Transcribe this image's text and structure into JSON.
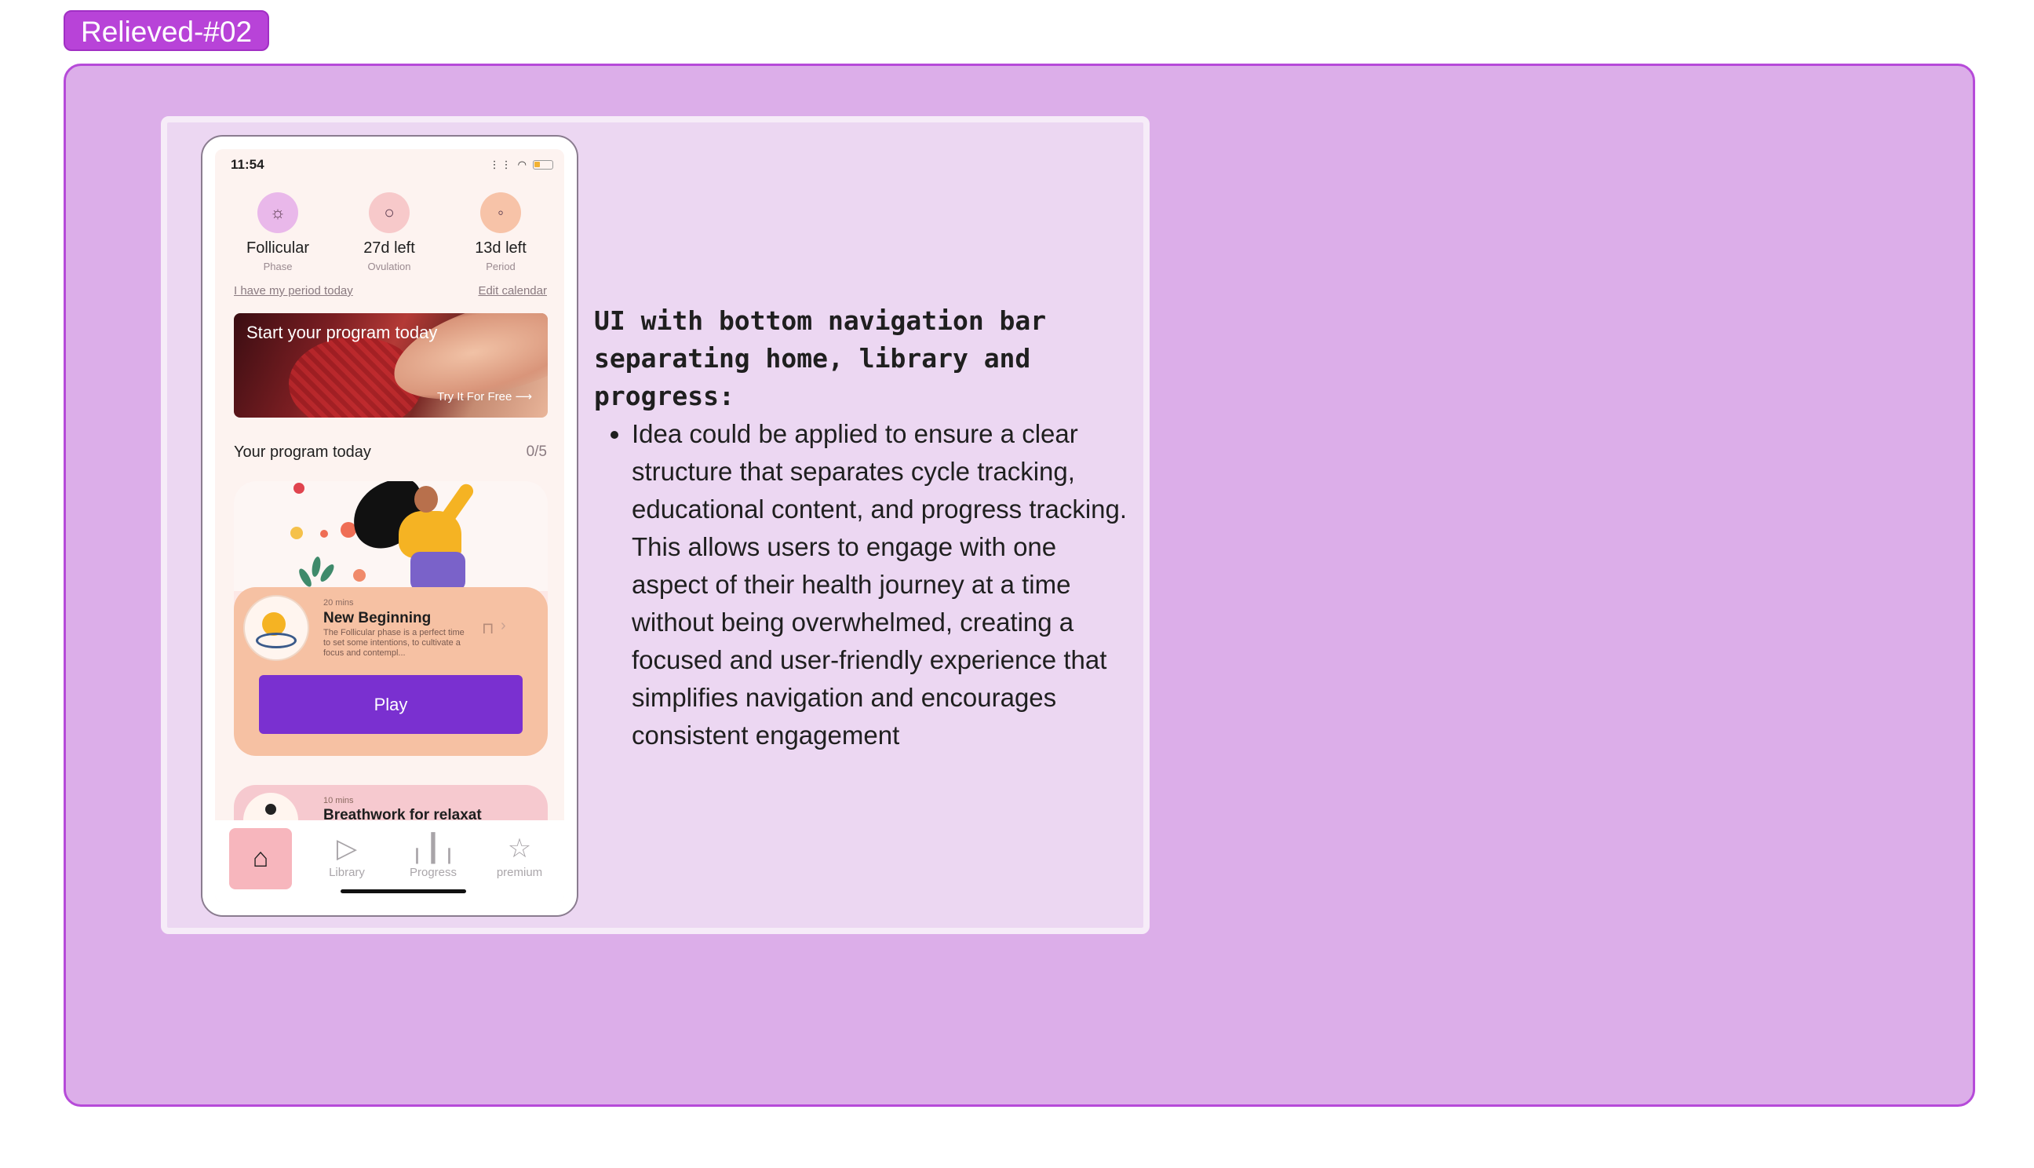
{
  "section": {
    "tag": "Relieved-#02"
  },
  "phone": {
    "status_time": "11:54",
    "stats": [
      {
        "value": "Follicular",
        "label": "Phase",
        "icon": "cloud-sun-icon",
        "color": "#e9b8ea"
      },
      {
        "value": "27d left",
        "label": "Ovulation",
        "icon": "circle-icon",
        "color": "#f7c9ca"
      },
      {
        "value": "13d left",
        "label": "Period",
        "icon": "drops-icon",
        "color": "#f7c3a8"
      }
    ],
    "period_link": "I have my period today",
    "edit_link": "Edit calendar",
    "banner": {
      "title": "Start your program today",
      "cta": "Try It For Free"
    },
    "program": {
      "title": "Your program today",
      "count": "0/5"
    },
    "lesson": {
      "duration": "20 mins",
      "name": "New Beginning",
      "description": "The Follicular phase  is a perfect time to set some intentions, to cultivate a focus and contempl...",
      "play_label": "Play"
    },
    "next_lesson": {
      "duration": "10 mins",
      "name": "Breathwork for relaxat"
    },
    "nav": [
      {
        "label": "",
        "icon": "home-icon",
        "active": true
      },
      {
        "label": "Library",
        "icon": "play-icon",
        "active": false
      },
      {
        "label": "Progress",
        "icon": "bars-icon",
        "active": false
      },
      {
        "label": "premium",
        "icon": "star-icon",
        "active": false
      }
    ]
  },
  "description": {
    "heading": "UI with bottom navigation bar separating home, library and progress:",
    "bullet": "Idea could be applied to ensure a clear structure that separates cycle tracking, educational content, and progress tracking. This allows users to engage with one aspect of their health journey at a time without being overwhelmed, creating a focused and user-friendly experience that simplifies navigation and encourages consistent engagement"
  },
  "colors": {
    "section_bg": "#dcaee9",
    "section_border": "#b64ad9",
    "accent": "#7a30d0",
    "tag": "#b843d8"
  }
}
